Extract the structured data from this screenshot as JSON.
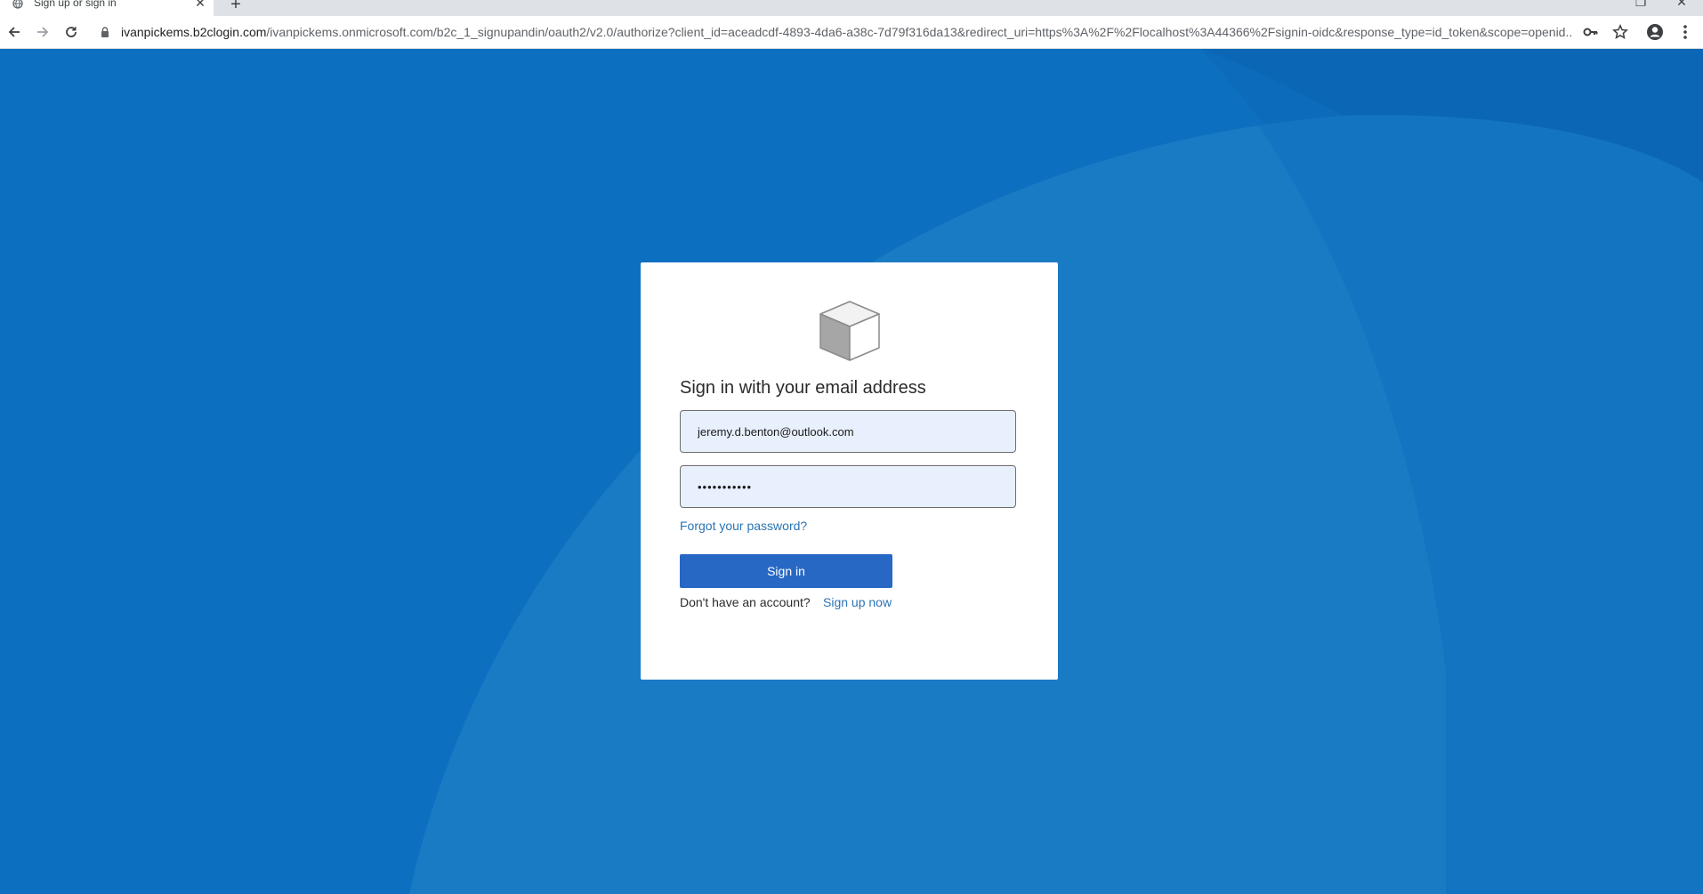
{
  "browser": {
    "tab": {
      "title": "Sign up or sign in",
      "close_glyph": "✕"
    },
    "new_tab_glyph": "+",
    "window_controls": {
      "restore_glyph": "❐",
      "close_glyph": "✕"
    },
    "address_bar": {
      "host": "ivanpickems.b2clogin.com",
      "path": "/ivanpickems.onmicrosoft.com/b2c_1_signupandin/oauth2/v2.0/authorize?client_id=aceadcdf-4893-4da6-a38c-7d79f316da13&redirect_uri=https%3A%2F%2Flocalhost%3A44366%2Fsignin-oidc&response_type=id_token&scope=openid..."
    },
    "icons": {
      "back": "back-arrow-icon",
      "forward": "forward-arrow-icon",
      "reload": "reload-icon",
      "lock": "lock-icon",
      "key": "key-icon",
      "star": "star-icon",
      "profile": "profile-icon",
      "menu": "kebab-menu-icon"
    }
  },
  "colors": {
    "page_background": "#0d6fc0",
    "button": "#2768c5",
    "link": "#2a74b4",
    "field_background": "#e8f0fe"
  },
  "signin": {
    "logo": "cube-logo",
    "heading": "Sign in with your email address",
    "email_value": "jeremy.d.benton@outlook.com",
    "password_value": "•••••••••••",
    "forgot_password": "Forgot your password?",
    "signin_button": "Sign in",
    "no_account_text": "Don't have an account?",
    "signup_link": "Sign up now"
  }
}
